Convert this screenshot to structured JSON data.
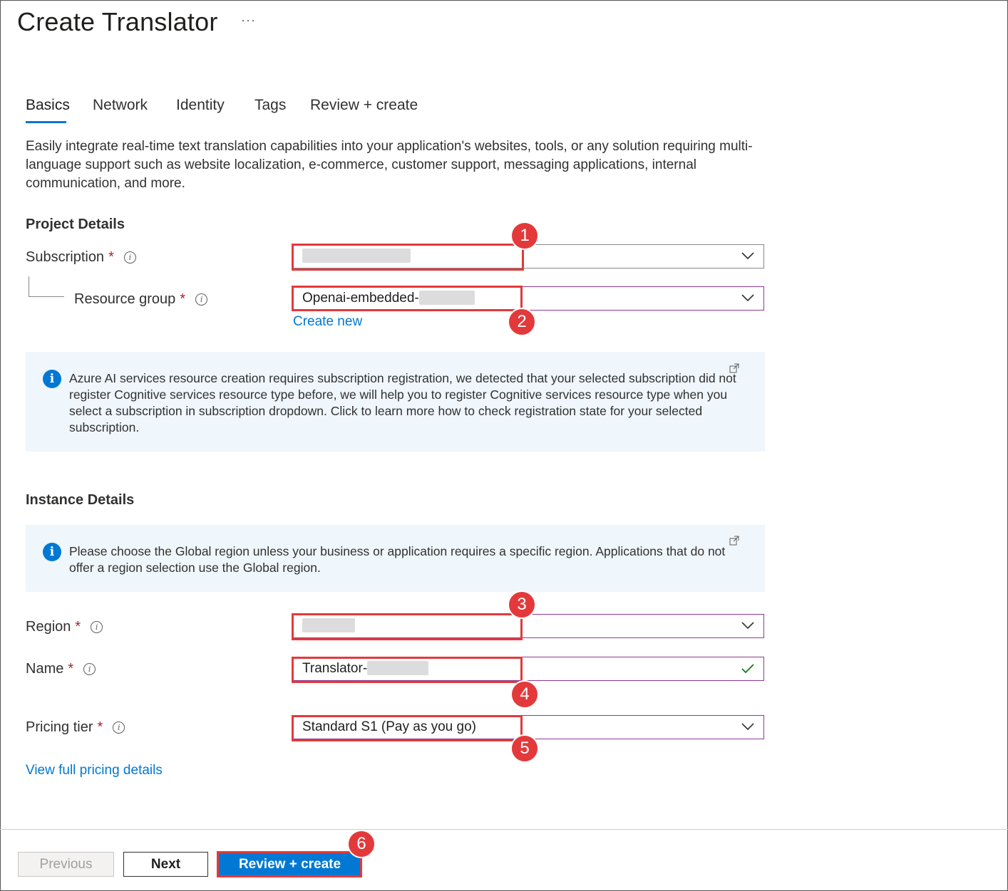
{
  "header": {
    "title": "Create Translator",
    "more_label": "···"
  },
  "tabs": [
    "Basics",
    "Network",
    "Identity",
    "Tags",
    "Review + create"
  ],
  "description": "Easily integrate real-time text translation capabilities into your application's websites, tools, or any solution requiring multi-language support such as website localization, e-commerce, customer support, messaging applications, internal communication, and more.",
  "project": {
    "heading": "Project Details",
    "subscription_label": "Subscription",
    "resource_group_label": "Resource group",
    "resource_group_value": "Openai-embedded-",
    "create_new": "Create new",
    "required_mark": "*",
    "info_glyph": "i"
  },
  "info_registration": "Azure AI services resource creation requires subscription registration, we detected that your selected subscription did not register Cognitive services resource type before, we will help you to register Cognitive services resource type when you select a subscription in subscription dropdown. Click to learn more how to check registration state for your selected subscription.",
  "instance": {
    "heading": "Instance Details",
    "info_region": "Please choose the Global region unless your business or application requires a specific region. Applications that do not offer a region selection use the Global region.",
    "region_label": "Region",
    "name_label": "Name",
    "name_value": "Translator-",
    "pricing_label": "Pricing tier",
    "pricing_value": "Standard S1 (Pay as you go)",
    "pricing_link": "View full pricing details"
  },
  "footer": {
    "previous": "Previous",
    "next": "Next",
    "review_create": "Review + create"
  },
  "badges": [
    "1",
    "2",
    "3",
    "4",
    "5",
    "6"
  ],
  "colors": {
    "accent": "#0078d4",
    "highlight": "#e3393b",
    "required": "#a4262c",
    "valid": "#107c10",
    "info_bg": "#eff6fc"
  }
}
